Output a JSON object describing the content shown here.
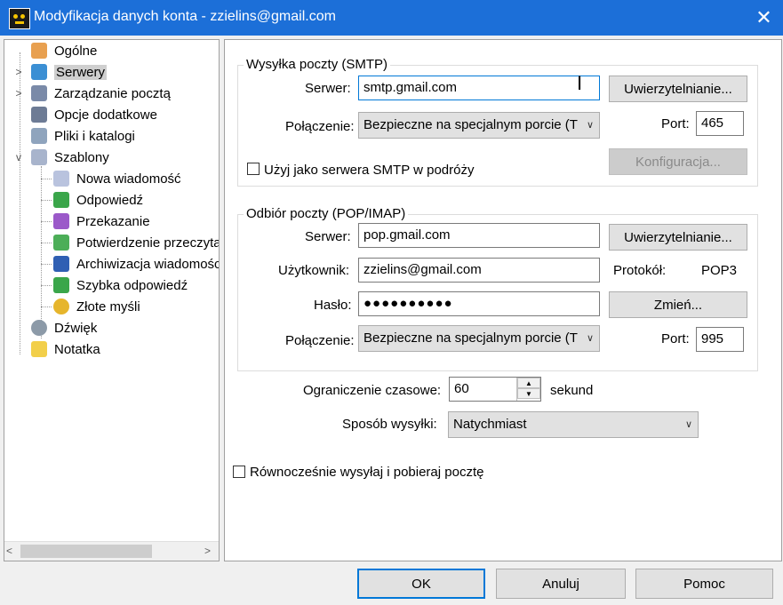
{
  "window": {
    "title": "Modyfikacja danych konta - zzielins@gmail.com",
    "close_glyph": "✕"
  },
  "tree": {
    "items": [
      {
        "label": "Ogólne",
        "icon": "general-icon"
      },
      {
        "label": "Serwery",
        "icon": "servers-icon"
      },
      {
        "label": "Zarządzanie pocztą",
        "icon": "mail-management-icon"
      },
      {
        "label": "Opcje dodatkowe",
        "icon": "options-icon"
      },
      {
        "label": "Pliki i katalogi",
        "icon": "files-icon"
      },
      {
        "label": "Szablony",
        "icon": "templates-icon"
      },
      {
        "label": "Nowa wiadomość",
        "icon": "new-message-icon"
      },
      {
        "label": "Odpowiedź",
        "icon": "reply-icon"
      },
      {
        "label": "Przekazanie",
        "icon": "forward-icon"
      },
      {
        "label": "Potwierdzenie przeczytania",
        "icon": "read-receipt-icon"
      },
      {
        "label": "Archiwizacja wiadomości",
        "icon": "archive-icon"
      },
      {
        "label": "Szybka odpowiedź",
        "icon": "quick-reply-icon"
      },
      {
        "label": "Złote myśli",
        "icon": "quotes-icon"
      },
      {
        "label": "Dźwięk",
        "icon": "sound-icon"
      },
      {
        "label": "Notatka",
        "icon": "note-icon"
      }
    ],
    "selected": "Serwery"
  },
  "smtp": {
    "group_title": "Wysyłka poczty (SMTP)",
    "server_label": "Serwer:",
    "server_value": "smtp.gmail.com",
    "auth_button": "Uwierzytelnianie...",
    "connection_label": "Połączenie:",
    "connection_value": "Bezpieczne na specjalnym porcie (T",
    "port_label": "Port:",
    "port_value": "465",
    "roaming_label": "Użyj jako serwera SMTP w podróży",
    "config_button": "Konfiguracja..."
  },
  "pop": {
    "group_title": "Odbiór poczty (POP/IMAP)",
    "server_label": "Serwer:",
    "server_value": "pop.gmail.com",
    "auth_button": "Uwierzytelnianie...",
    "user_label": "Użytkownik:",
    "user_value": "zzielins@gmail.com",
    "protocol_label": "Protokół:",
    "protocol_value": "POP3",
    "password_label": "Hasło:",
    "password_value": "●●●●●●●●●●",
    "change_button": "Zmień...",
    "connection_label": "Połączenie:",
    "connection_value": "Bezpieczne na specjalnym porcie (T",
    "port_label": "Port:",
    "port_value": "995"
  },
  "timeout": {
    "label": "Ograniczenie czasowe:",
    "value": "60",
    "unit": "sekund"
  },
  "send_mode": {
    "label": "Sposób wysyłki:",
    "value": "Natychmiast"
  },
  "simultaneous_label": "Równocześnie wysyłaj i pobieraj pocztę",
  "footer": {
    "ok": "OK",
    "cancel": "Anuluj",
    "help": "Pomoc"
  }
}
